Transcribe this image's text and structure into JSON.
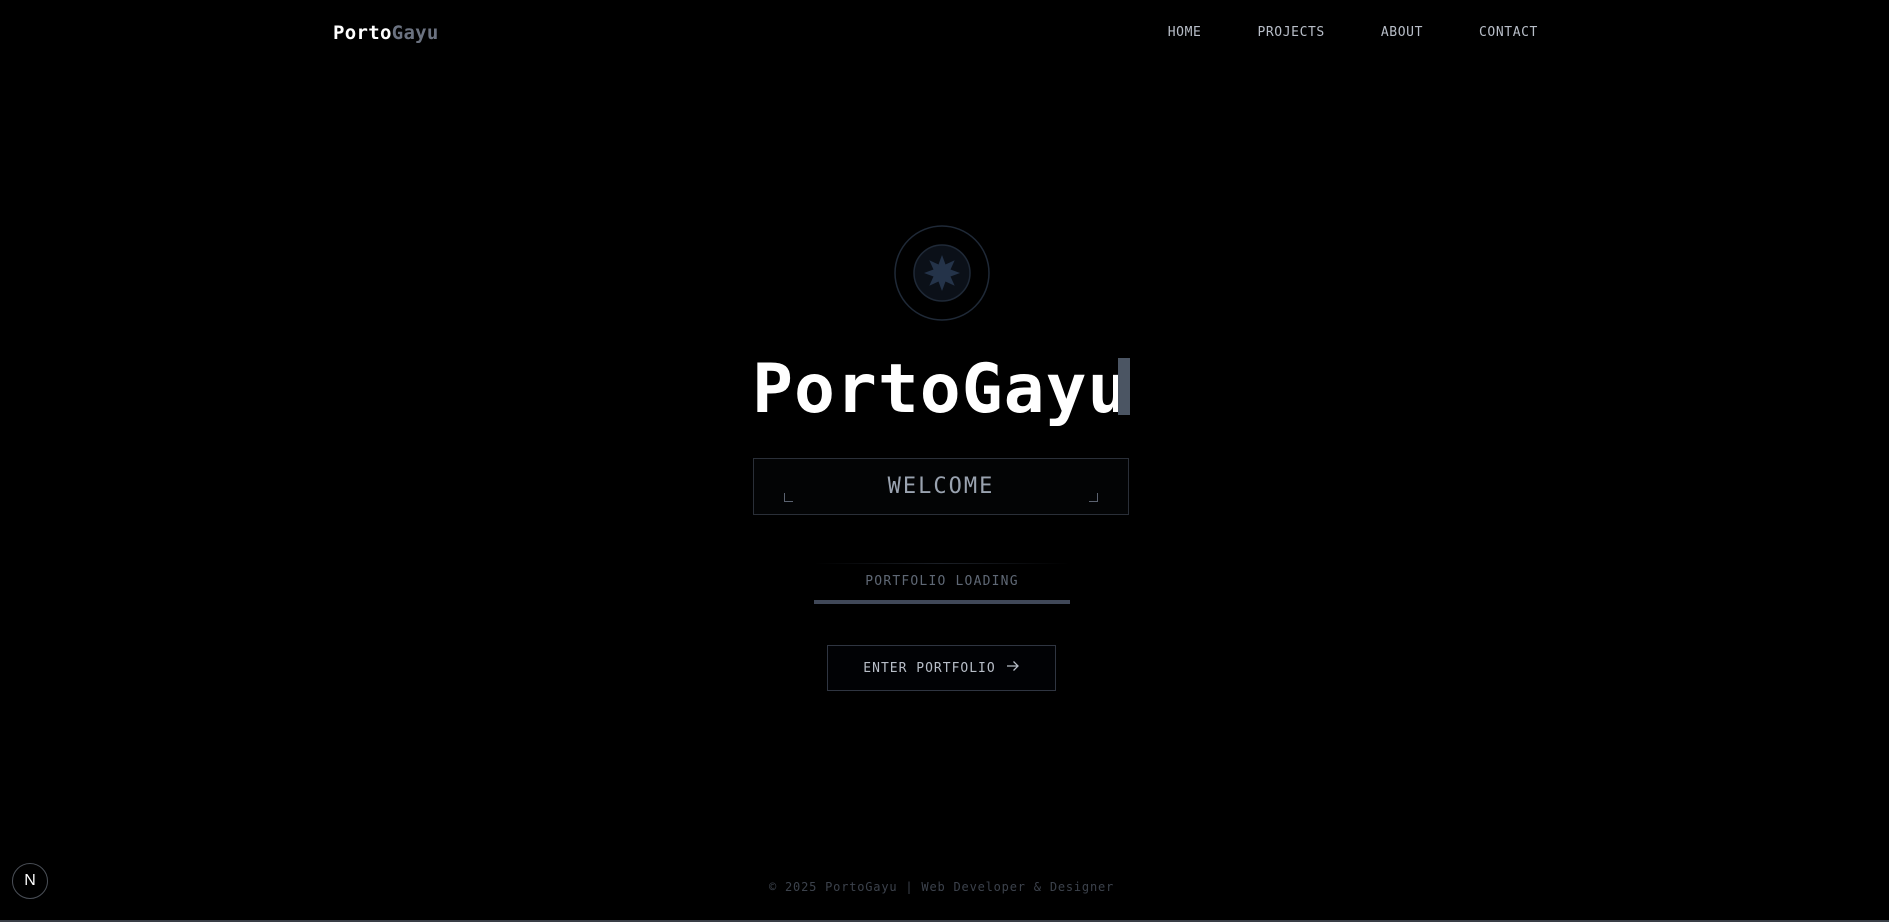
{
  "header": {
    "logo_part1": "Porto",
    "logo_part2": "Gayu",
    "nav": [
      {
        "label": "HOME"
      },
      {
        "label": "PROJECTS"
      },
      {
        "label": "ABOUT"
      },
      {
        "label": "CONTACT"
      }
    ]
  },
  "hero": {
    "emblem_icon": "starburst-emblem-icon",
    "title": "PortoGayu",
    "welcome": "WELCOME",
    "loading_label": "PORTFOLIO LOADING",
    "loading_progress": 1.0,
    "enter_button": "ENTER PORTFOLIO",
    "enter_icon": "arrow-right-icon"
  },
  "footer": {
    "text": "© 2025 PortoGayu | Web Developer & Designer"
  },
  "badge": {
    "label": "N",
    "icon": "nextjs-badge-icon"
  },
  "colors": {
    "background": "#000000",
    "accent": "#404858",
    "text_muted": "#6b7280"
  }
}
